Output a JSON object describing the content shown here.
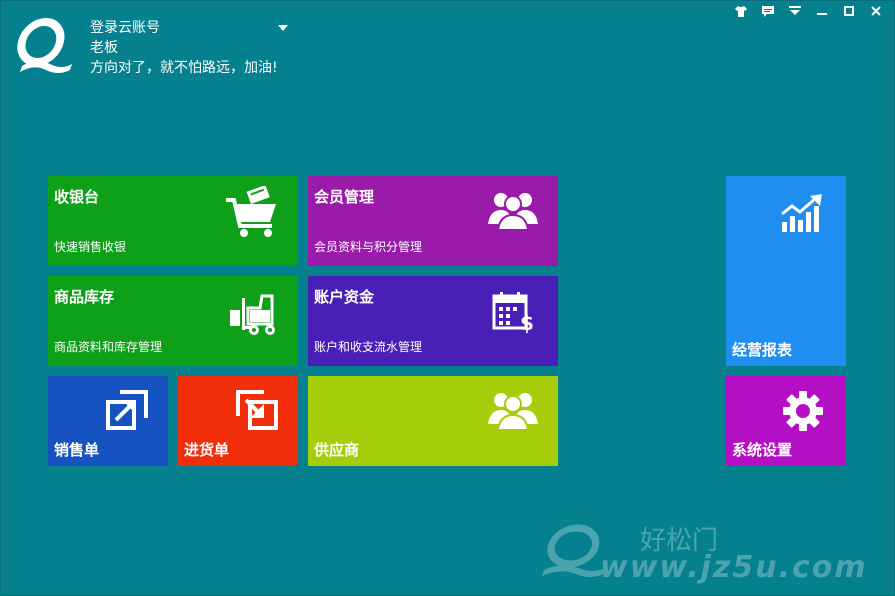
{
  "account": {
    "login_label": "登录云账号",
    "username": "老板",
    "motto": "方向对了，就不怕路远，加油!"
  },
  "window_controls": [
    {
      "name": "skin-icon"
    },
    {
      "name": "message-icon"
    },
    {
      "name": "menu-icon"
    },
    {
      "name": "minimize-icon"
    },
    {
      "name": "maximize-icon"
    },
    {
      "name": "close-icon"
    }
  ],
  "tiles": {
    "cashier": {
      "title": "收银台",
      "desc": "快速销售收银",
      "color": "#0fa019"
    },
    "members": {
      "title": "会员管理",
      "desc": "会员资料与积分管理",
      "color": "#9a1aa9"
    },
    "inventory": {
      "title": "商品库存",
      "desc": "商品资料和库存管理",
      "color": "#0fa019"
    },
    "accounts": {
      "title": "账户资金",
      "desc": "账户和收支流水管理",
      "color": "#4a1fb8"
    },
    "sales_order": {
      "title": "销售单",
      "color": "#1653c0"
    },
    "purchase_order": {
      "title": "进货单",
      "color": "#f12d0a"
    },
    "suppliers": {
      "title": "供应商",
      "color": "#a6cd0a"
    },
    "reports": {
      "title": "经营报表",
      "color": "#1e8ef0"
    },
    "settings": {
      "title": "系统设置",
      "color": "#b40fc4"
    }
  },
  "watermark": {
    "brand": "好松门",
    "url": "www.jz5u.com"
  }
}
